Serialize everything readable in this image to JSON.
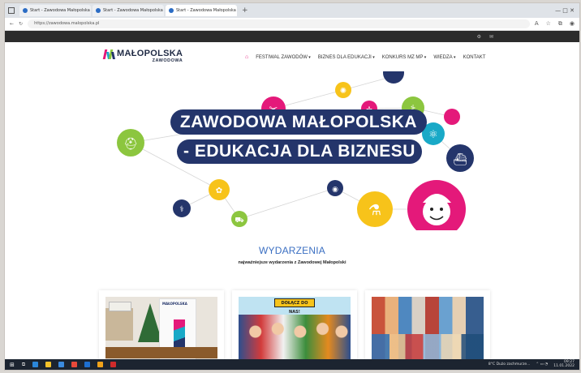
{
  "browser": {
    "tabs": [
      {
        "title": "Start - Zawodowa Małopolska",
        "active": false
      },
      {
        "title": "Start - Zawodowa Małopolska",
        "active": false
      },
      {
        "title": "Start - Zawodowa Małopolska",
        "active": true
      }
    ],
    "new_tab": "+",
    "url": "https://zawodowa.malopolska.pl",
    "controls": "—   □   ✕"
  },
  "topstrip": {
    "icons": [
      "cookie-icon",
      "mail-icon"
    ]
  },
  "site": {
    "logo_line1": "MAŁOPOLSKA",
    "logo_line2": "ZAWODOWA",
    "nav": [
      {
        "label": "FESTIWAL ZAWODÓW",
        "dropdown": true
      },
      {
        "label": "BIZNES DLA EDUKACJI",
        "dropdown": true
      },
      {
        "label": "KONKURS MZ MP",
        "dropdown": true
      },
      {
        "label": "WIEDZA",
        "dropdown": true
      },
      {
        "label": "KONTAKT",
        "dropdown": false
      }
    ]
  },
  "hero": {
    "line1": "ZAWODOWA MAŁOPOLSKA",
    "line2": "- EDUKACJA DLA BIZNESU"
  },
  "events": {
    "title": "WYDARZENIA",
    "subtitle": "najważniejsze wydarzenia z Zawodowej Małopolski",
    "card2_caption": "DOŁĄCZ DO NAS!",
    "card1_logo": "MAŁOPOLSKA"
  },
  "taskbar": {
    "weather": "8°C  Dużo zachmurze...",
    "time": "09:27",
    "date": "11.01.2022"
  },
  "colors": {
    "navy": "#24356b",
    "magenta": "#e4197a",
    "green": "#8cc63f",
    "yellow": "#f7c31a",
    "teal": "#19a9c7",
    "accent_blue": "#3b6fc2"
  }
}
